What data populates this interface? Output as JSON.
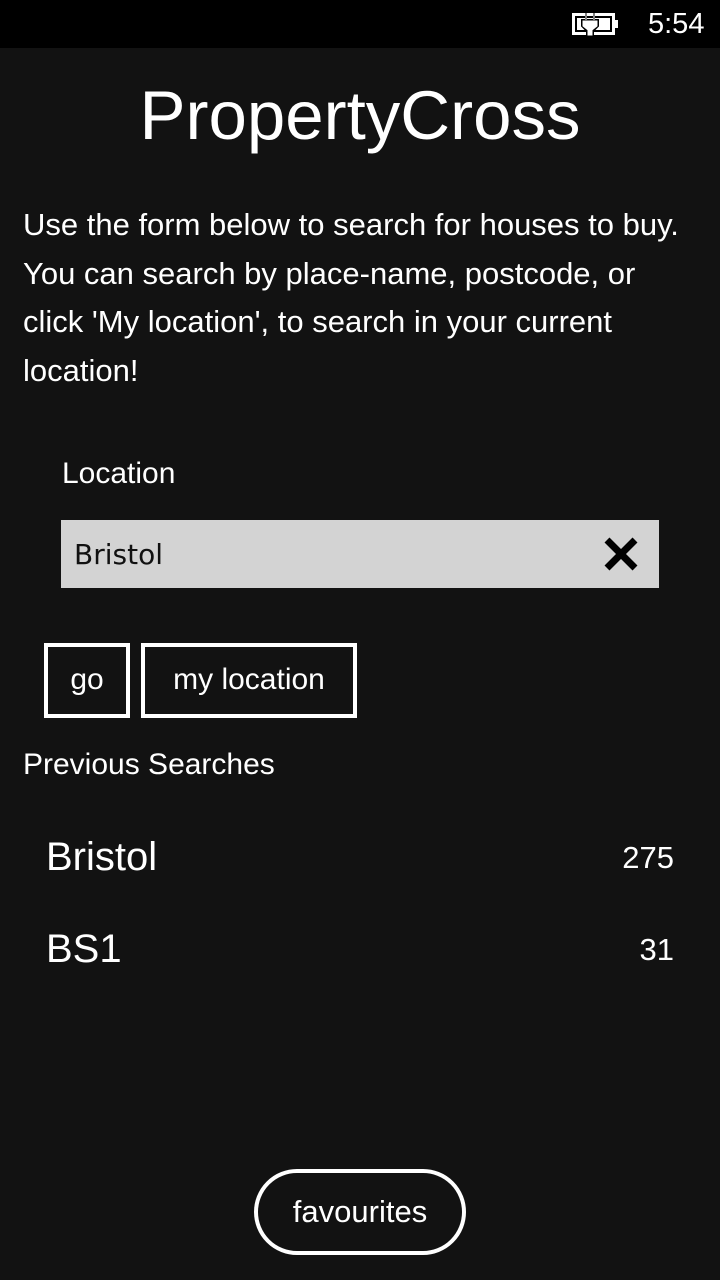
{
  "status_bar": {
    "time": "5:54",
    "battery_icon": "battery-charging-icon"
  },
  "app": {
    "title": "PropertyCross"
  },
  "intro": {
    "text": "Use the form below to search for houses to buy. You can search by place-name, postcode, or click 'My location', to search in your current location!"
  },
  "search": {
    "label": "Location",
    "value": "Bristol",
    "clear_icon": "close-icon",
    "go_label": "go",
    "my_location_label": "my location"
  },
  "previous_searches": {
    "heading": "Previous Searches",
    "items": [
      {
        "name": "Bristol",
        "count": "275"
      },
      {
        "name": "BS1",
        "count": "31"
      }
    ]
  },
  "footer": {
    "favourites_label": "favourites"
  },
  "colors": {
    "background": "#121212",
    "status_bar": "#000000",
    "text": "#ffffff",
    "input_background": "#d3d3d3"
  }
}
